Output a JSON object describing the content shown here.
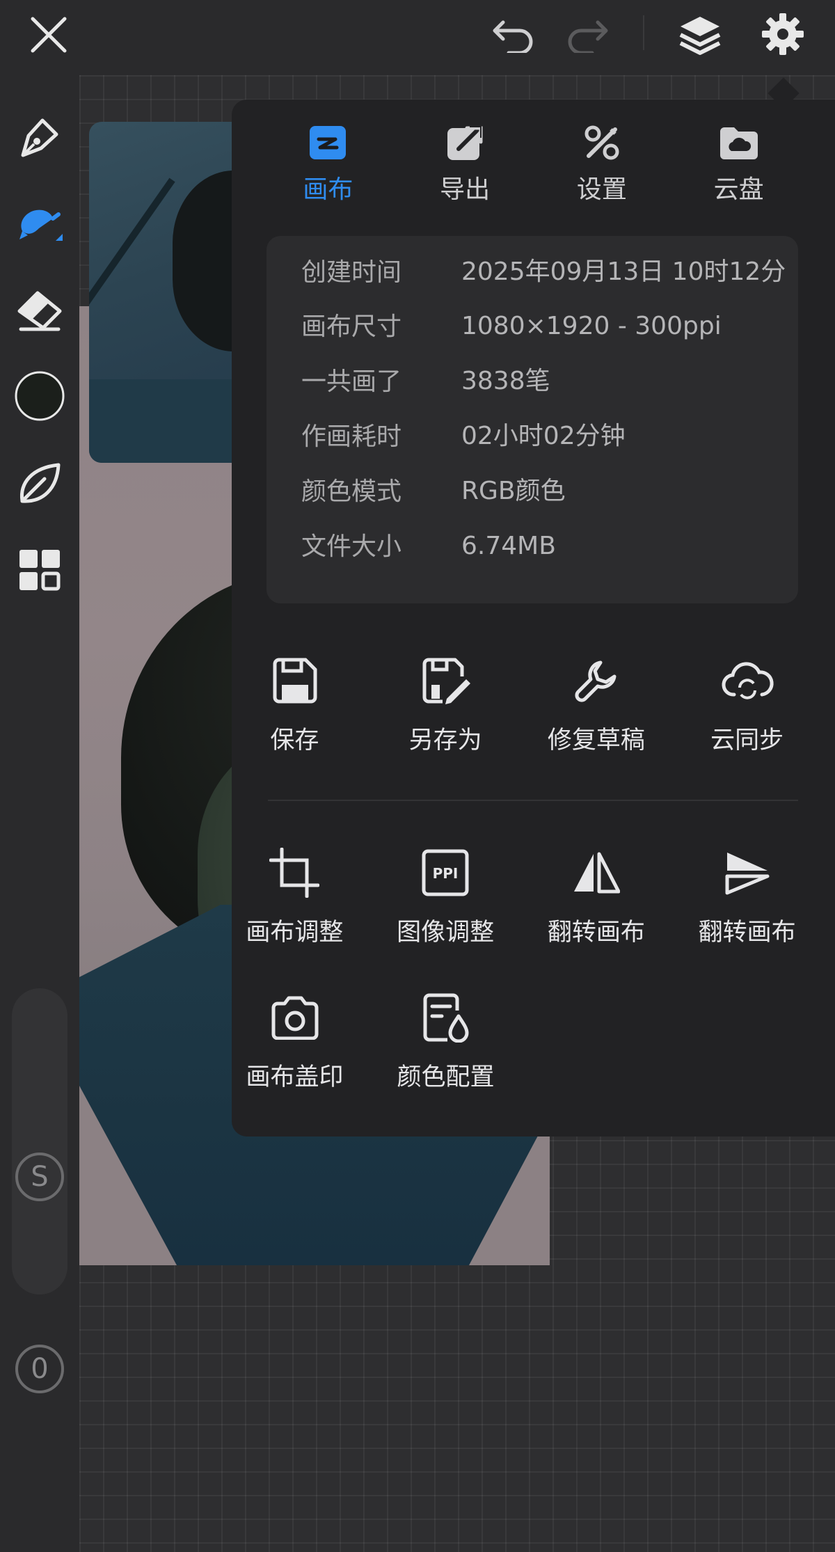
{
  "colors": {
    "accent": "#2f8cf0",
    "panel_bg": "#222224",
    "info_bg": "#2c2c2e"
  },
  "top_bar": {
    "icons": [
      "close-icon",
      "undo-icon",
      "redo-icon",
      "layers-icon",
      "gear-icon"
    ]
  },
  "left_toolbar": {
    "tools": [
      "pen-icon",
      "brush-icon",
      "eraser-icon",
      "color-swatch",
      "leaf-icon",
      "grid-icon"
    ],
    "s_label": "S",
    "zero_label": "0"
  },
  "tabs": [
    {
      "label": "画布",
      "icon": "canvas-icon",
      "active": true
    },
    {
      "label": "导出",
      "icon": "export-icon",
      "active": false
    },
    {
      "label": "设置",
      "icon": "tools-icon",
      "active": false
    },
    {
      "label": "云盘",
      "icon": "cloud-drive-icon",
      "active": false
    }
  ],
  "info": [
    {
      "key": "创建时间",
      "value": "2025年09月13日 10时12分"
    },
    {
      "key": "画布尺寸",
      "value": "1080×1920 - 300ppi"
    },
    {
      "key": "一共画了",
      "value": "3838笔"
    },
    {
      "key": "作画耗时",
      "value": "02小时02分钟"
    },
    {
      "key": "颜色模式",
      "value": "RGB颜色"
    },
    {
      "key": "文件大小",
      "value": "6.74MB"
    }
  ],
  "actions_row1": [
    {
      "label": "保存",
      "icon": "save-icon"
    },
    {
      "label": "另存为",
      "icon": "save-as-icon"
    },
    {
      "label": "修复草稿",
      "icon": "wrench-icon"
    },
    {
      "label": "云同步",
      "icon": "cloud-sync-icon"
    }
  ],
  "actions_row2": [
    {
      "label": "画布调整",
      "icon": "crop-icon"
    },
    {
      "label": "图像调整",
      "icon": "ppi-icon"
    },
    {
      "label": "翻转画布",
      "icon": "flip-horizontal-icon"
    },
    {
      "label": "翻转画布",
      "icon": "flip-vertical-icon"
    }
  ],
  "actions_row3": [
    {
      "label": "画布盖印",
      "icon": "camera-stamp-icon"
    },
    {
      "label": "颜色配置",
      "icon": "color-profile-icon"
    }
  ]
}
